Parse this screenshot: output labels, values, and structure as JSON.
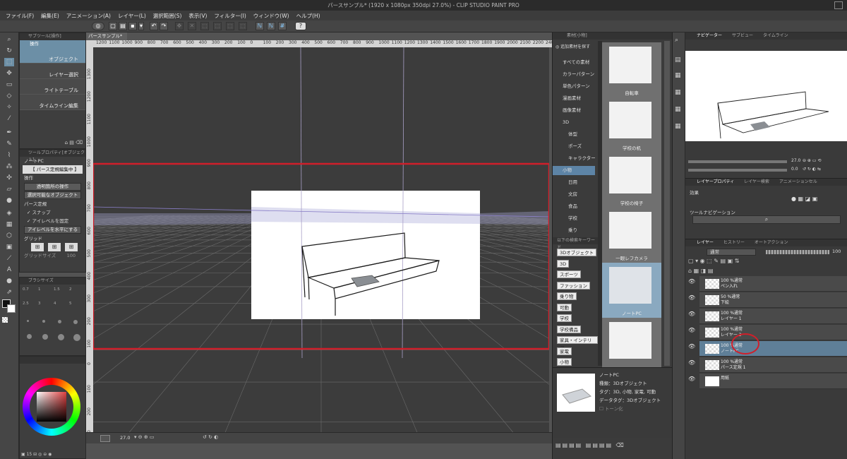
{
  "window": {
    "title": "パースサンプル* (1920 x 1080px 350dpi 27.0%) - CLIP STUDIO PAINT PRO"
  },
  "menu": [
    "ファイル(F)",
    "編集(E)",
    "アニメーション(A)",
    "レイヤー(L)",
    "選択範囲(S)",
    "表示(V)",
    "フィルター(I)",
    "ウィンドウ(W)",
    "ヘルプ(H)"
  ],
  "subtool": {
    "header": "サブツール[操作]",
    "group": "操作",
    "items": [
      "オブジェクト",
      "レイヤー選択",
      "ライトテーブル",
      "タイムライン編集"
    ]
  },
  "toolprop": {
    "header": "ツールプロパティ[オブジェクト]",
    "object_name": "ノートPC",
    "perspective_title": "【 パース定規編集中 】",
    "operation_label": "操作",
    "transparent_select": "透明箇所の操作",
    "selectable_object": "選択可能なオブジェクト",
    "perspective_label": "パース定規",
    "snap": "スナップ",
    "fix_eye_level": "アイレベルを固定",
    "eye_level_horizontal": "アイレベルを水平にする",
    "grid_label": "グリッド",
    "grid_size_label": "グリッドサイズ",
    "grid_size_value": "100"
  },
  "brushsize": {
    "header": "ブラシサイズ",
    "values": [
      "0.7",
      "1",
      "1.5",
      "2",
      "2.5",
      "3",
      "4",
      "5"
    ]
  },
  "color": {
    "footer_value": "15"
  },
  "canvas": {
    "doc_tab": "パースサンプル*",
    "ruler_h": [
      "1200",
      "1100",
      "1000",
      "900",
      "800",
      "700",
      "600",
      "500",
      "400",
      "300",
      "200",
      "100",
      "0",
      "100",
      "200",
      "300",
      "400",
      "500",
      "600",
      "700",
      "800",
      "900",
      "1000",
      "1100",
      "1200",
      "1300",
      "1400",
      "1500",
      "1600",
      "1700",
      "1800",
      "1900",
      "2000",
      "2100",
      "2200",
      "240"
    ],
    "ruler_v": [
      "1300",
      "1200",
      "1100",
      "1000",
      "900",
      "800",
      "700",
      "600",
      "500",
      "400",
      "300",
      "200",
      "100",
      "0",
      "100",
      "200",
      "300"
    ],
    "zoom": "27.0"
  },
  "materials": {
    "header": "素材[小物]",
    "search_hint": "追加素材を探す",
    "tree": [
      "すべての素材",
      "カラーパターン",
      "単色パターン",
      "漫画素材",
      "画像素材",
      "3D",
      "体型",
      "ポーズ",
      "キャラクター",
      "小物",
      "日用",
      "文房",
      "食品",
      "学校",
      "乗り"
    ],
    "tags_header": "以下の検索キーワード",
    "tags": [
      "3Dオブジェクト",
      "3D",
      "スポーツ",
      "ファッション",
      "乗り物",
      "可動",
      "学校",
      "学校備品",
      "家具・インテリア",
      "家電",
      "小物"
    ],
    "items": [
      "自転車",
      "学校の机",
      "学校の椅子",
      "一眼レフカメラ",
      "ノートPC",
      ""
    ],
    "detail": {
      "name": "ノートPC",
      "type": "種類：3Dオブジェクト",
      "tags": "タグ：3D, 小物, 家電, 可動",
      "datatag": "データタグ：3Dオブジェクト",
      "tone": "トーン化"
    }
  },
  "navigator": {
    "tab": "ナビゲーター",
    "tab2": "サブビュー",
    "tab3": "タイムライン",
    "zoom": "27.0",
    "angle": "0.0"
  },
  "layerprop": {
    "tab": "レイヤープロパティ",
    "tab2": "レイヤー検索",
    "tab3": "アニメーションセル",
    "effect_label": "効果",
    "toolnav_label": "ツールナビゲーション"
  },
  "layers": {
    "tab": "レイヤー",
    "tab2": "ヒストリー",
    "tab3": "オートアクション",
    "blend": "通常",
    "opacity": "100",
    "rows": [
      {
        "top": "100 %通常",
        "name": "ペン入れ"
      },
      {
        "top": "50 %通常",
        "name": "下絵"
      },
      {
        "top": "100 %通常",
        "name": "レイヤー 1"
      },
      {
        "top": "100 %通常",
        "name": "レイヤー 2"
      },
      {
        "top": "100 %通常",
        "name": "ノートPC"
      },
      {
        "top": "100 %通常",
        "name": "パース定規 1"
      },
      {
        "top": "",
        "name": "用紙"
      }
    ]
  },
  "colors": {
    "highlight": "#d01f2a",
    "selection": "#5d84a6"
  }
}
